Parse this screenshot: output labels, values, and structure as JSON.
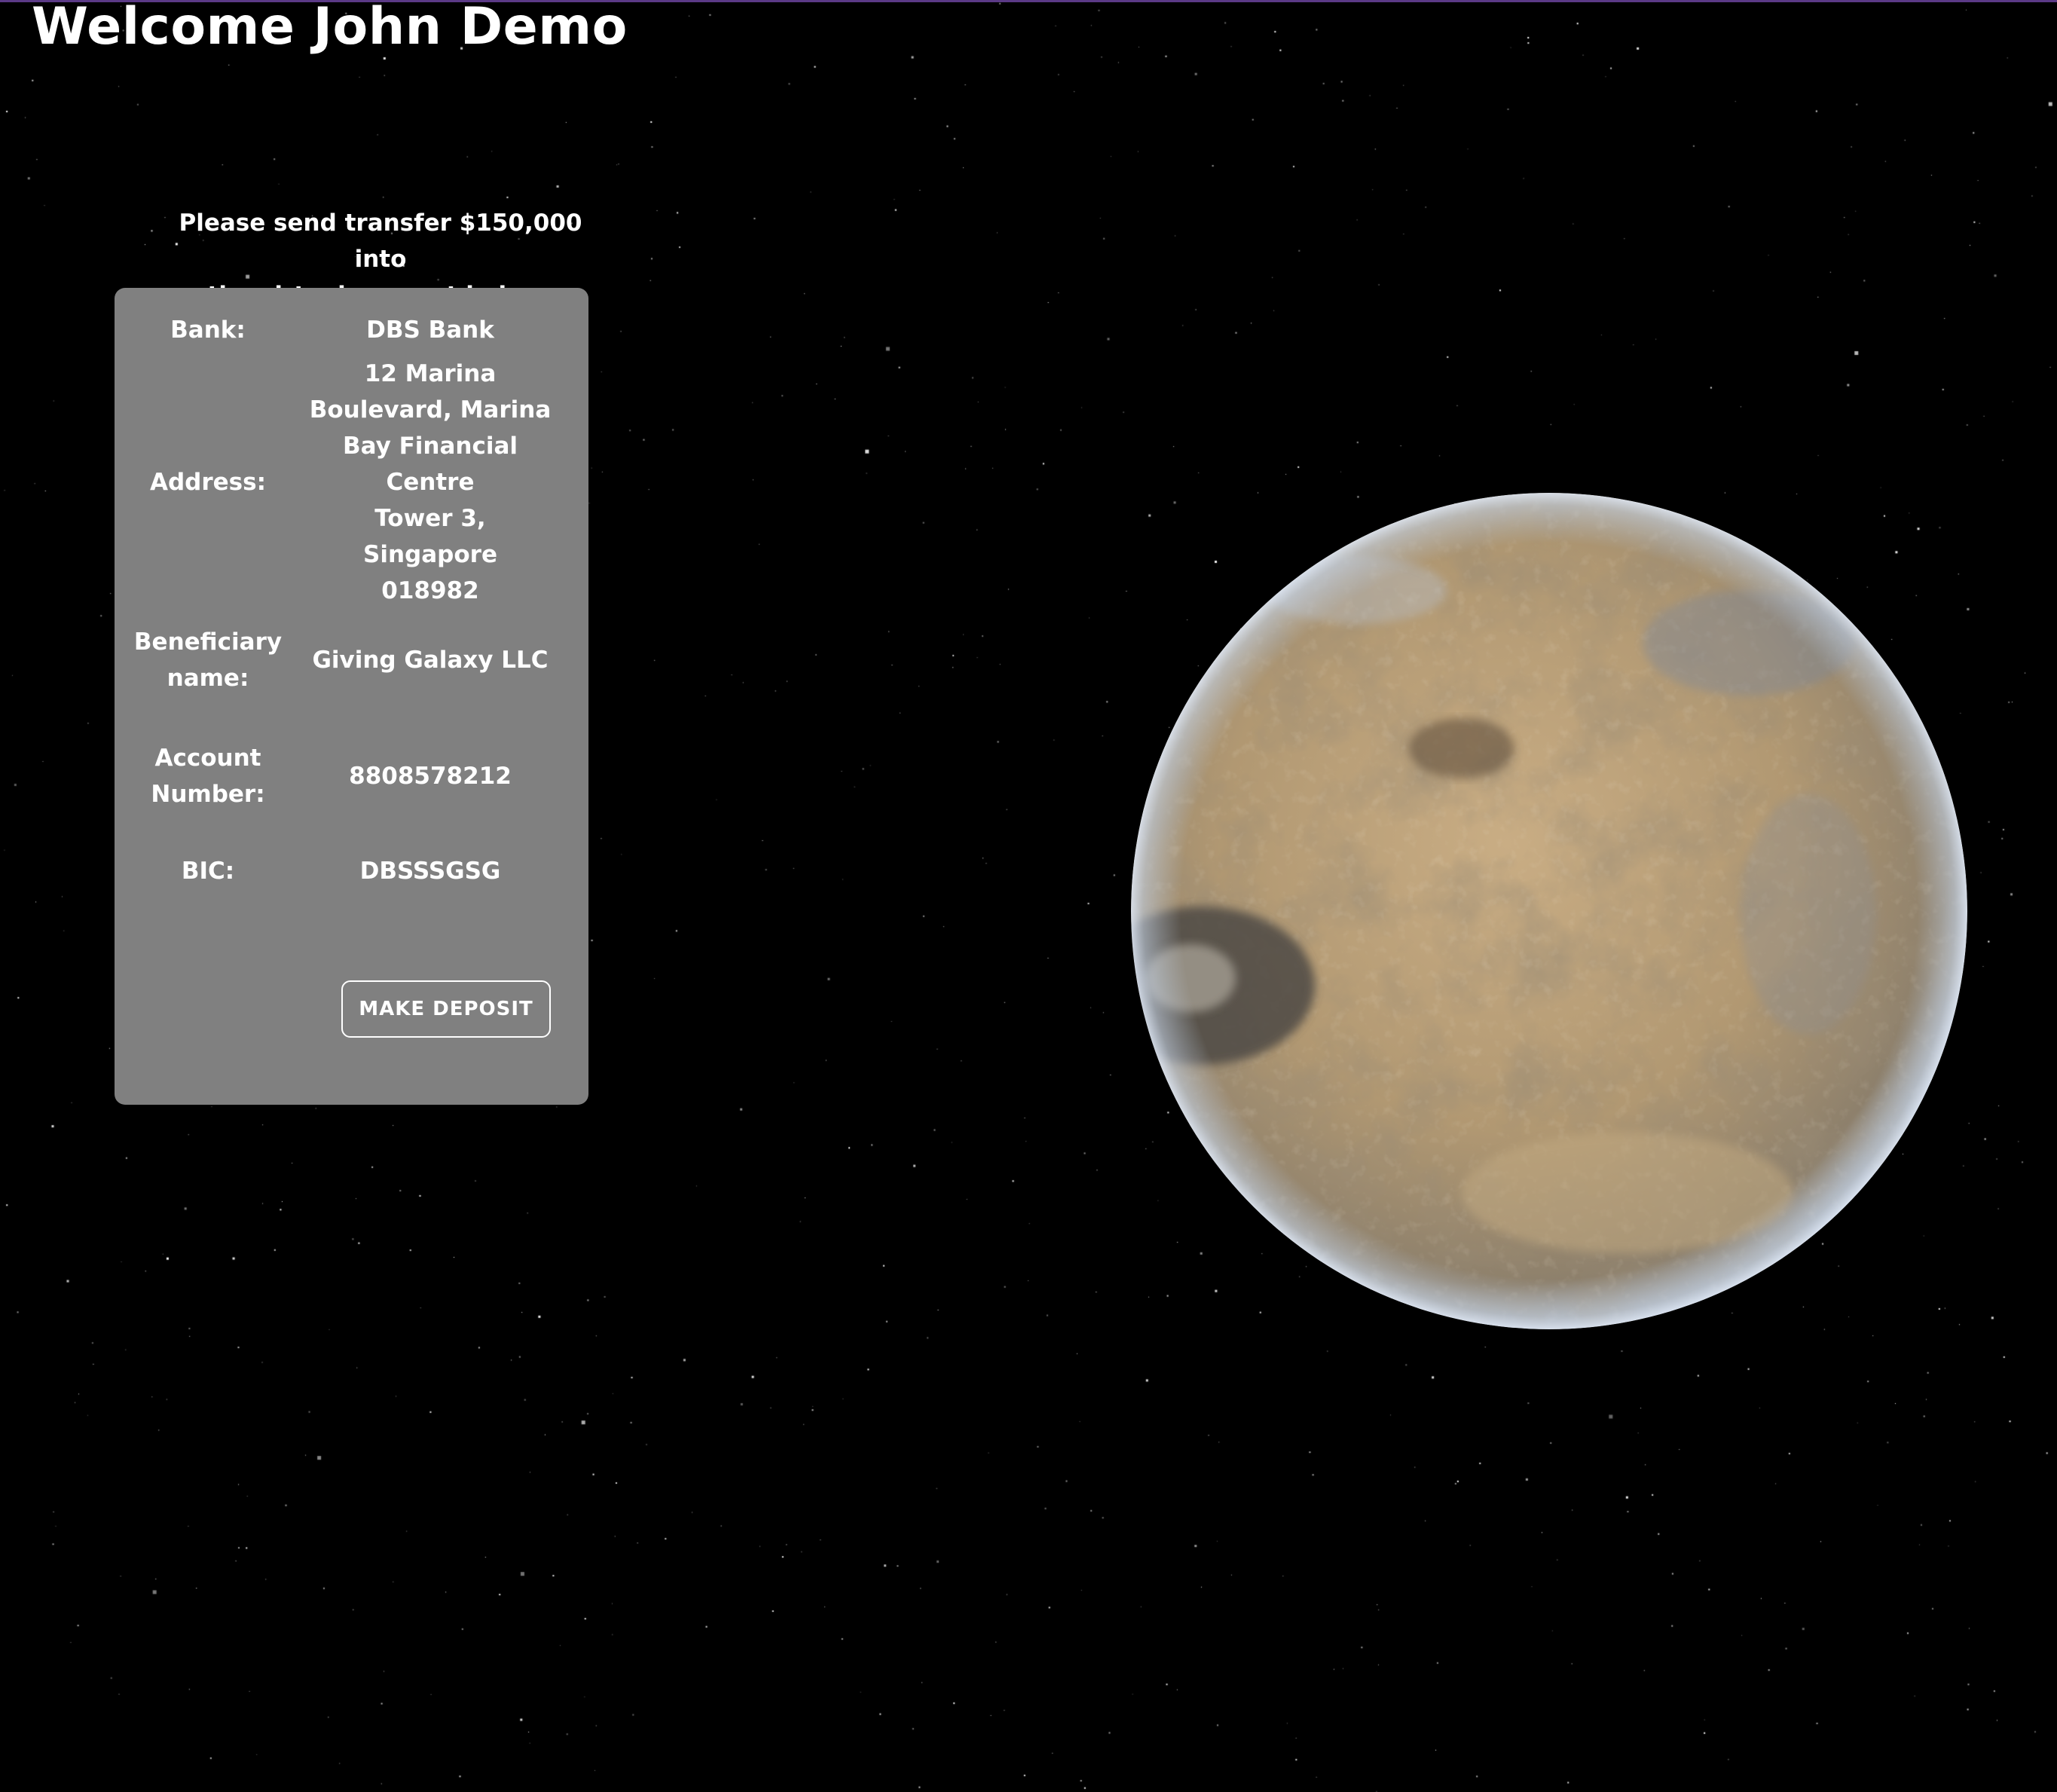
{
  "header": {
    "welcome": "Welcome John Demo"
  },
  "instruction": {
    "line1": "Please send transfer $150,000 into",
    "line2": "the virtual account below:"
  },
  "account_details": {
    "bank_label": "Bank:",
    "bank_value": "DBS Bank",
    "address_label": "Address:",
    "address_lines": [
      "12 Marina",
      "Boulevard, Marina",
      "Bay Financial Centre",
      "Tower 3, Singapore",
      "018982"
    ],
    "beneficiary_label_lines": [
      "Beneficiary",
      "name:"
    ],
    "beneficiary_value": "Giving Galaxy LLC",
    "account_label_lines": [
      "Account",
      "Number:"
    ],
    "account_value": "8808578212",
    "bic_label": "BIC:",
    "bic_value": "DBSSSGSG"
  },
  "actions": {
    "deposit_label": "MAKE DEPOSIT"
  },
  "theme": {
    "background": "#000000",
    "card_background": "#808080",
    "text_color": "#ffffff",
    "top_rule_color": "#5b3a86"
  }
}
